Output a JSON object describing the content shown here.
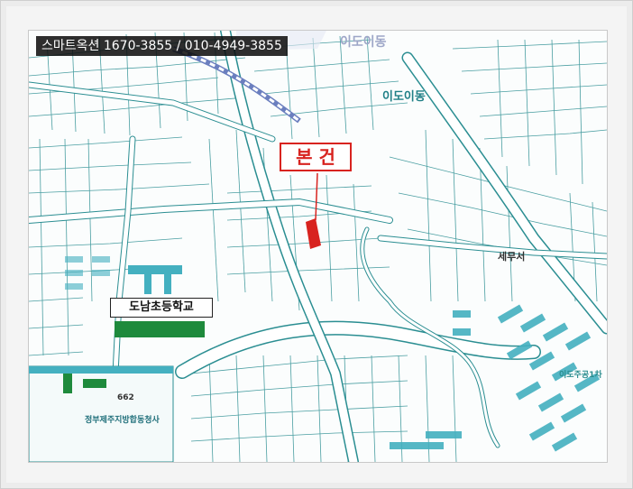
{
  "banner": {
    "text": "스마트옥션 1670-3855 / 010-4949-3855"
  },
  "map": {
    "subject_label": "본 건",
    "school_label": "도남초등학교",
    "place_labels": {
      "idong_top": "이도이동",
      "idong_mid": "이도이동",
      "tax_office": "세무서",
      "idosjugong": "이도주공1차",
      "office": "정부제주지방합동청사",
      "lot_662": "662"
    },
    "colors": {
      "road": "#ffffff",
      "block_fill": "#f7fbfb",
      "block_line": "#2b8e92",
      "subject": "#d8231f",
      "school": "#1e8a3c",
      "apartment": "#44b0c0",
      "highway": "#6b7fbf"
    }
  }
}
